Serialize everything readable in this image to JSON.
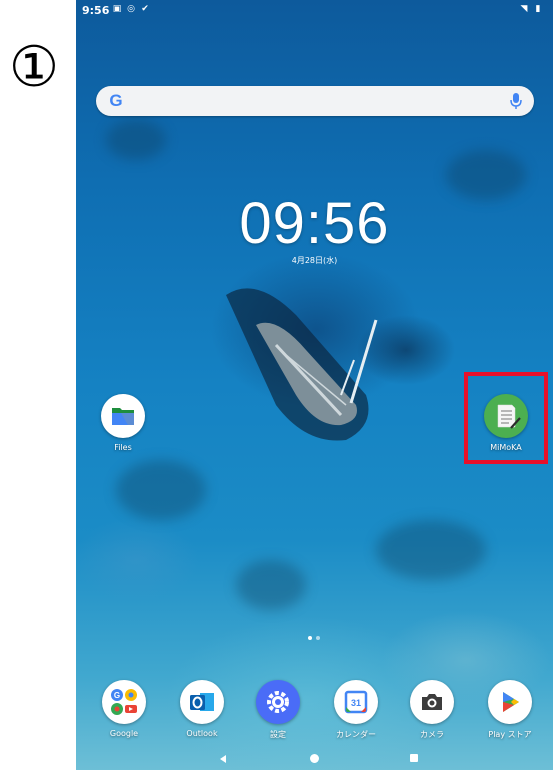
{
  "step_marker": "①",
  "status_bar": {
    "time": "9:56"
  },
  "search": {
    "logo": "G",
    "mic_icon": "mic-icon"
  },
  "lock": {
    "clock": "09:56",
    "date": "4月28日(水)"
  },
  "apps": {
    "files": {
      "label": "Files",
      "icon": "files-icon"
    },
    "mimoka": {
      "label": "MiMoKA",
      "icon": "notepad-icon"
    }
  },
  "dock": [
    {
      "label": "Google",
      "icon": "google-folder-icon"
    },
    {
      "label": "Outlook",
      "icon": "outlook-icon"
    },
    {
      "label": "設定",
      "icon": "gear-icon"
    },
    {
      "label": "カレンダー",
      "icon": "calendar-icon",
      "day": "31"
    },
    {
      "label": "カメラ",
      "icon": "camera-icon"
    },
    {
      "label": "Play ストア",
      "icon": "play-store-icon"
    }
  ],
  "colors": {
    "highlight": "#e8102a",
    "search_bg": "#f2f3f5"
  }
}
